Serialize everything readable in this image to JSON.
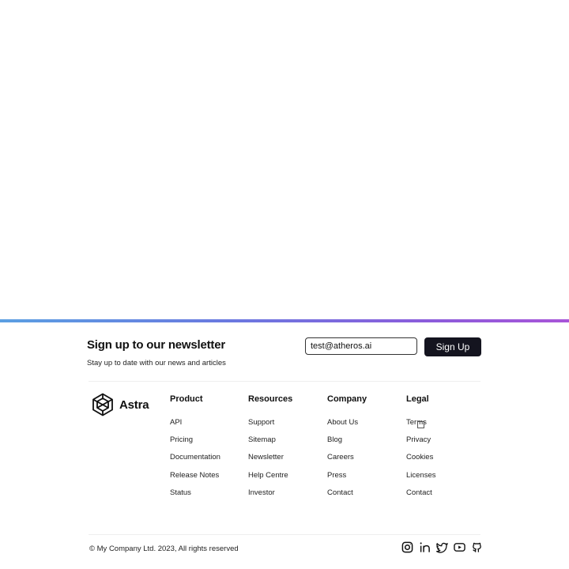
{
  "newsletter": {
    "title": "Sign up to our newsletter",
    "subtitle": "Stay up to date with our news and articles",
    "email_value": "test@atheros.ai",
    "button_label": "Sign Up"
  },
  "brand": {
    "name": "Astra",
    "logo_icon": "hexagon-cube-logo-icon"
  },
  "columns": [
    {
      "title": "Product",
      "links": [
        "API",
        "Pricing",
        "Documentation",
        "Release Notes",
        "Status"
      ]
    },
    {
      "title": "Resources",
      "links": [
        "Support",
        "Sitemap",
        "Newsletter",
        "Help Centre",
        "Investor"
      ]
    },
    {
      "title": "Company",
      "links": [
        "About Us",
        "Blog",
        "Careers",
        "Press",
        "Contact"
      ]
    },
    {
      "title": "Legal",
      "links": [
        "Terms",
        "Privacy",
        "Cookies",
        "Licenses",
        "Contact"
      ]
    }
  ],
  "copyright": "© My Company Ltd. 2023, All rights reserved",
  "social_icons": [
    "instagram-icon",
    "linkedin-icon",
    "twitter-icon",
    "youtube-icon",
    "github-icon"
  ],
  "colors": {
    "gradient_start": "#5b9fe2",
    "gradient_end": "#a855d8",
    "button_bg": "#14141f",
    "text": "#111111"
  }
}
